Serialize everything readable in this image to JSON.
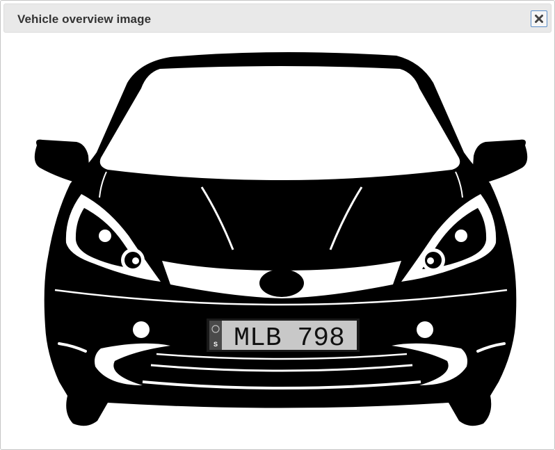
{
  "dialog": {
    "title": "Vehicle overview image",
    "close_icon": "close-icon"
  },
  "vehicle": {
    "plate_number": "MLB 798",
    "plate_country": "S"
  },
  "colors": {
    "titlebar_bg": "#e9e9e9",
    "close_border": "#5b8ec9",
    "car_body": "#000000",
    "plate_bg": "#c8c8c8"
  }
}
